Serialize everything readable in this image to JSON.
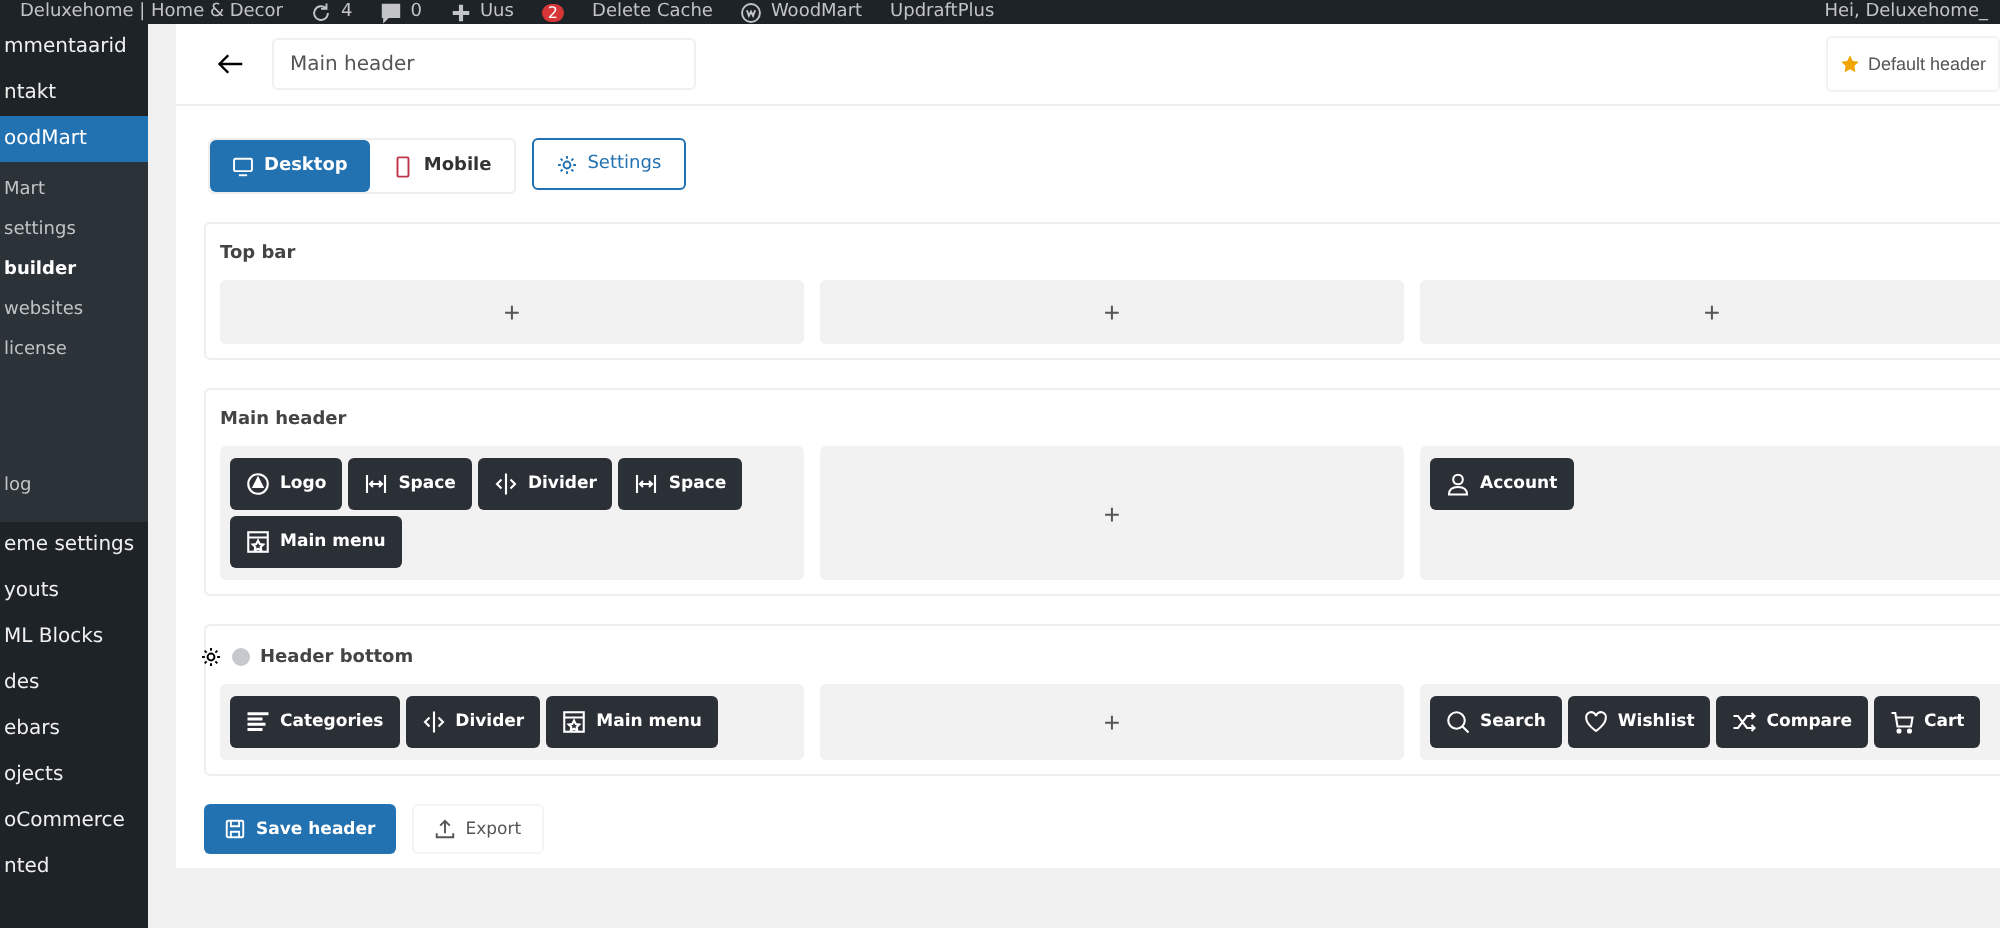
{
  "admin_bar": {
    "items": [
      {
        "kind": "site",
        "label": "Deluxehome | Home & Decor"
      },
      {
        "kind": "updates",
        "label": "4"
      },
      {
        "kind": "comments",
        "label": "0"
      },
      {
        "kind": "new",
        "label": "Uus"
      },
      {
        "kind": "badge",
        "label": "2"
      },
      {
        "kind": "text",
        "label": "Delete Cache"
      },
      {
        "kind": "woodmart",
        "label": "WoodMart"
      },
      {
        "kind": "text",
        "label": "UpdraftPlus"
      }
    ],
    "greeting": "Hei, Deluxehome_"
  },
  "sidebar": {
    "items": [
      {
        "kind": "top",
        "label": "mmentaarid",
        "selected": false
      },
      {
        "kind": "top",
        "label": "ntakt",
        "selected": false
      },
      {
        "kind": "top",
        "label": "oodMart",
        "selected": true
      },
      {
        "kind": "sub",
        "label": "Mart",
        "selected": false
      },
      {
        "kind": "sub",
        "label": "settings",
        "selected": false
      },
      {
        "kind": "sub",
        "label": "builder",
        "selected": true
      },
      {
        "kind": "sub",
        "label": "websites",
        "selected": false
      },
      {
        "kind": "sub",
        "label": "license",
        "selected": false
      },
      {
        "kind": "gap",
        "label": "log",
        "selected": false
      },
      {
        "kind": "top",
        "label": "eme settings",
        "selected": false
      },
      {
        "kind": "top",
        "label": "youts",
        "selected": false
      },
      {
        "kind": "top",
        "label": "ML Blocks",
        "selected": false
      },
      {
        "kind": "top",
        "label": "des",
        "selected": false
      },
      {
        "kind": "top",
        "label": "ebars",
        "selected": false
      },
      {
        "kind": "top",
        "label": "ojects",
        "selected": false
      },
      {
        "kind": "top",
        "label": "oCommerce",
        "selected": false
      },
      {
        "kind": "top",
        "label": "nted",
        "selected": false
      }
    ]
  },
  "header_name": {
    "value": "Main header"
  },
  "default_button": "Default header",
  "device_tabs": [
    {
      "kind": "desktop",
      "label": "Desktop",
      "selected": true
    },
    {
      "kind": "mobile",
      "label": "Mobile",
      "selected": false
    }
  ],
  "settings_button": "Settings",
  "rows": [
    {
      "kind": "plain",
      "title": "Top bar",
      "columns": [
        {
          "kind": "empty",
          "add": "+"
        },
        {
          "kind": "empty",
          "add": "+"
        },
        {
          "kind": "empty",
          "add": "+"
        }
      ]
    },
    {
      "kind": "plain",
      "title": "Main header",
      "columns": [
        {
          "kind": "elements",
          "elements": [
            {
              "kind": "logo",
              "label": "Logo"
            },
            {
              "kind": "space",
              "label": "Space"
            },
            {
              "kind": "divider",
              "label": "Divider"
            },
            {
              "kind": "space",
              "label": "Space"
            },
            {
              "kind": "menu",
              "label": "Main menu"
            }
          ]
        },
        {
          "kind": "empty",
          "add": "+"
        },
        {
          "kind": "elements",
          "elements": [
            {
              "kind": "account",
              "label": "Account"
            }
          ]
        }
      ]
    },
    {
      "kind": "configurable",
      "title": "Header bottom",
      "columns": [
        {
          "kind": "elements",
          "elements": [
            {
              "kind": "categories",
              "label": "Categories"
            },
            {
              "kind": "divider",
              "label": "Divider"
            },
            {
              "kind": "menu",
              "label": "Main menu"
            }
          ]
        },
        {
          "kind": "empty",
          "add": "+"
        },
        {
          "kind": "elements",
          "elements": [
            {
              "kind": "search",
              "label": "Search"
            },
            {
              "kind": "heart",
              "label": "Wishlist"
            },
            {
              "kind": "compare",
              "label": "Compare"
            },
            {
              "kind": "cart",
              "label": "Cart"
            }
          ]
        }
      ]
    }
  ],
  "save_button": "Save header",
  "export_button": "Export"
}
